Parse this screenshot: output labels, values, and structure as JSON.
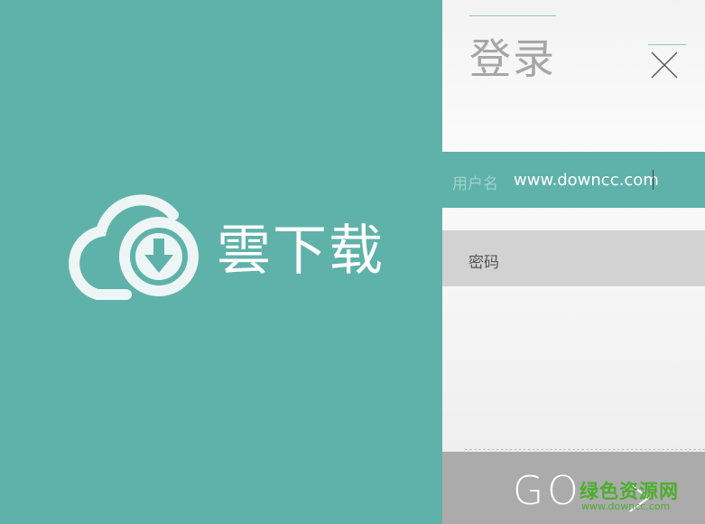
{
  "brand": {
    "name": "雲下载",
    "logo_icon": "cloud-download-icon"
  },
  "login": {
    "title": "登录",
    "close_icon": "close-icon",
    "username_label": "用户名",
    "username_value": "www.downcc.com",
    "password_label": "密码",
    "go_label": "GO",
    "go_icon": "chevron-right-icon"
  },
  "watermark": {
    "main": "绿色资源网",
    "sub": "www.downcc.com"
  },
  "colors": {
    "accent": "#5fb2aa",
    "panel": "#f3f3f3",
    "password_bg": "#d2d2d2",
    "go_bg": "#ababab",
    "watermark": "#4cae2d"
  }
}
